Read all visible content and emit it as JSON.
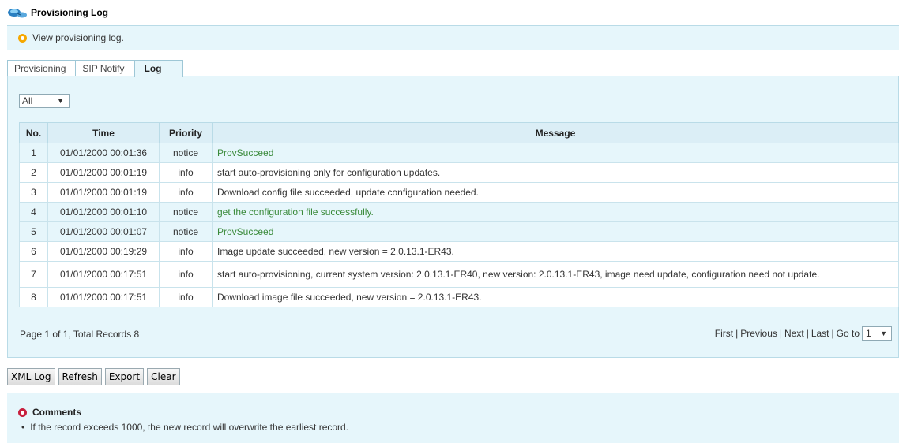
{
  "header": {
    "title": "Provisioning Log",
    "icon": "network-icon"
  },
  "info": {
    "text": "View provisioning log."
  },
  "tabs": [
    {
      "label": "Provisioning",
      "selected": false
    },
    {
      "label": "SIP Notify",
      "selected": false
    },
    {
      "label": "Log",
      "selected": true
    }
  ],
  "filter": {
    "value": "All"
  },
  "table": {
    "headers": [
      "No.",
      "Time",
      "Priority",
      "Message"
    ],
    "rows": [
      {
        "no": "1",
        "time": "01/01/2000 00:01:36",
        "priority": "notice",
        "message": "ProvSucceed"
      },
      {
        "no": "2",
        "time": "01/01/2000 00:01:19",
        "priority": "info",
        "message": "start auto-provisioning only for configuration updates."
      },
      {
        "no": "3",
        "time": "01/01/2000 00:01:19",
        "priority": "info",
        "message": "Download config file succeeded, update configuration needed."
      },
      {
        "no": "4",
        "time": "01/01/2000 00:01:10",
        "priority": "notice",
        "message": "get the configuration file successfully."
      },
      {
        "no": "5",
        "time": "01/01/2000 00:01:07",
        "priority": "notice",
        "message": "ProvSucceed"
      },
      {
        "no": "6",
        "time": "01/01/2000 00:19:29",
        "priority": "info",
        "message": "Image update succeeded, new version = 2.0.13.1-ER43."
      },
      {
        "no": "7",
        "time": "01/01/2000 00:17:51",
        "priority": "info",
        "message": "start auto-provisioning, current system version: 2.0.13.1-ER40, new version: 2.0.13.1-ER43, image need update, configuration need not update."
      },
      {
        "no": "8",
        "time": "01/01/2000 00:17:51",
        "priority": "info",
        "message": "Download image file succeeded, new version = 2.0.13.1-ER43."
      }
    ]
  },
  "pager": {
    "summary": "Page 1 of 1,  Total Records 8",
    "first": "First",
    "previous": "Previous",
    "next": "Next",
    "last": "Last",
    "goto_label": "Go to",
    "goto_value": "1"
  },
  "buttons": {
    "xml_log": "XML Log",
    "refresh": "Refresh",
    "export": "Export",
    "clear": "Clear"
  },
  "comments": {
    "title": "Comments",
    "items": [
      "If the record exceeds 1000, the new record will overwrite the earliest record."
    ]
  }
}
